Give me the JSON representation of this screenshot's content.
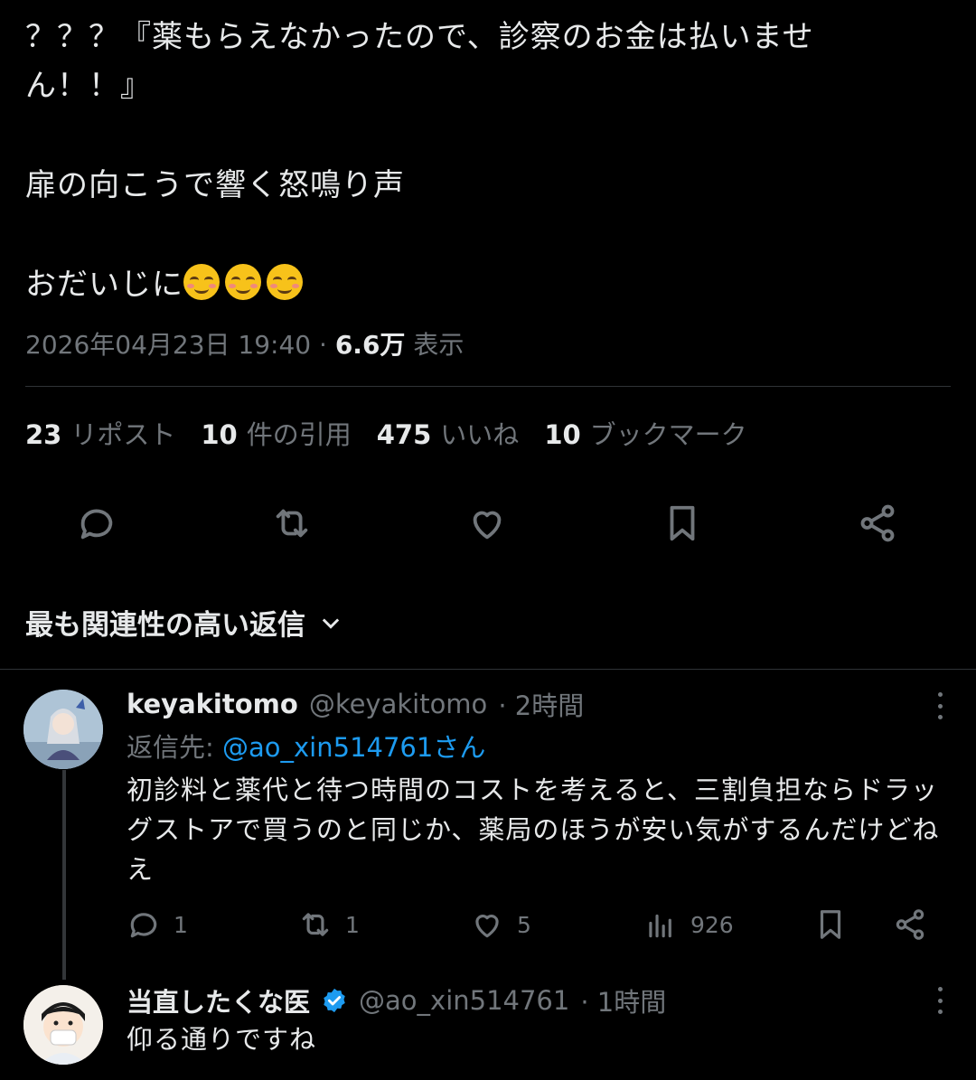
{
  "tweet": {
    "lines": [
      "？？？『薬もらえなかったので、診察のお金は払いませ",
      "ん！！』",
      "扉の向こうで響く怒鳴り声",
      "おだいじに"
    ],
    "timestamp": "2026年04月23日 19:40",
    "separator": "·",
    "views_count": "6.6万",
    "views_label": "表示"
  },
  "stats": {
    "reposts_count": "23",
    "reposts_label": "リポスト",
    "quotes_count": "10",
    "quotes_label": "件の引用",
    "likes_count": "475",
    "likes_label": "いいね",
    "bookmarks_count": "10",
    "bookmarks_label": "ブックマーク"
  },
  "actions": [
    "reply-icon",
    "repost-icon",
    "like-icon",
    "bookmark-icon",
    "share-icon"
  ],
  "sort": {
    "label": "最も関連性の高い返信"
  },
  "replies": [
    {
      "name": "keyakitomo",
      "handle": "@keyakitomo",
      "time": "· 2時間",
      "reply_to_label": "返信先: ",
      "reply_to_mention": "@ao_xin514761さん",
      "body": "初診料と薬代と待つ時間のコストを考えると、三割負担ならドラッグストアで買うのと同じか、薬局のほうが安い気がするんだけどねえ",
      "reply_count": "1",
      "repost_count": "1",
      "like_count": "5",
      "view_count": "926"
    },
    {
      "name": "当直したくな医",
      "handle": "@ao_xin514761",
      "time": "· 1時間",
      "verified": true,
      "body": "仰る通りですね"
    }
  ],
  "colors": {
    "background": "#000000",
    "text": "#e7e9ea",
    "muted": "#71767b",
    "accent": "#1d9bf0",
    "divider": "#2f3336"
  }
}
